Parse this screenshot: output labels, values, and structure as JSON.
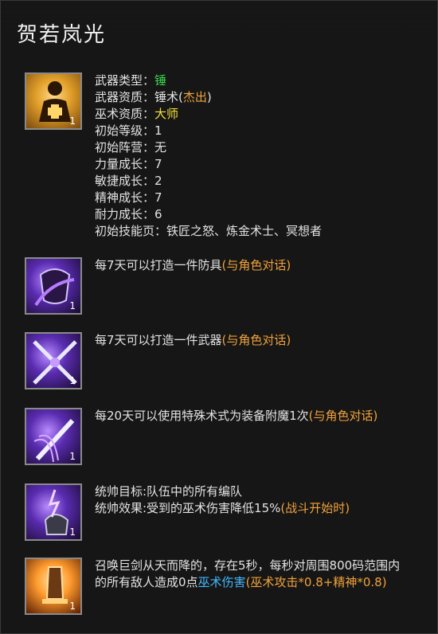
{
  "title": "贺若岚光",
  "header": {
    "icon_name": "hero-plus-icon",
    "count": "1",
    "lines": [
      {
        "label": "武器类型：",
        "value": "锤",
        "value_color": "#39d84b"
      },
      {
        "label": "武器资质：",
        "value": "锤术(",
        "value2": "杰出",
        "value3": ")"
      },
      {
        "label": "巫术资质：",
        "value": "大师",
        "value_color": "#f4e33a"
      },
      {
        "label": "初始等级：",
        "value": "1"
      },
      {
        "label": "初始阵营：",
        "value": "无"
      },
      {
        "label": "力量成长：",
        "value": "7"
      },
      {
        "label": "敏捷成长：",
        "value": "2"
      },
      {
        "label": "精神成长：",
        "value": "7"
      },
      {
        "label": "耐力成长：",
        "value": "6"
      },
      {
        "label": "初始技能页：",
        "value": "铁匠之怒、炼金术士、冥想者"
      }
    ]
  },
  "skills": [
    {
      "icon_name": "armor-anvil-icon",
      "count": "1",
      "text_main": "每7天可以打造一件防具",
      "text_extra": "(与角色对话)"
    },
    {
      "icon_name": "crossed-swords-icon",
      "count": "1",
      "text_main": "每7天可以打造一件武器",
      "text_extra": "(与角色对话)"
    },
    {
      "icon_name": "enchant-sword-icon",
      "count": "1",
      "text_main": "每20天可以使用特殊术式为装备附魔1次",
      "text_extra": "(与角色对话)"
    },
    {
      "icon_name": "lightning-helmet-icon",
      "count": "1",
      "line1": "统帅目标:队伍中的所有编队",
      "line2_main": "统帅效果:受到的巫术伤害降低15%",
      "line2_extra": "(战斗开始时)"
    },
    {
      "icon_name": "giant-sword-icon",
      "count": "1",
      "text_main": "召唤巨剑从天而降的，存在5秒，每秒对周围800码范围内的所有敌人造成0点",
      "text_blue": "巫术伤害",
      "text_extra": "(巫术攻击*0.8+精神*0.8)"
    }
  ]
}
